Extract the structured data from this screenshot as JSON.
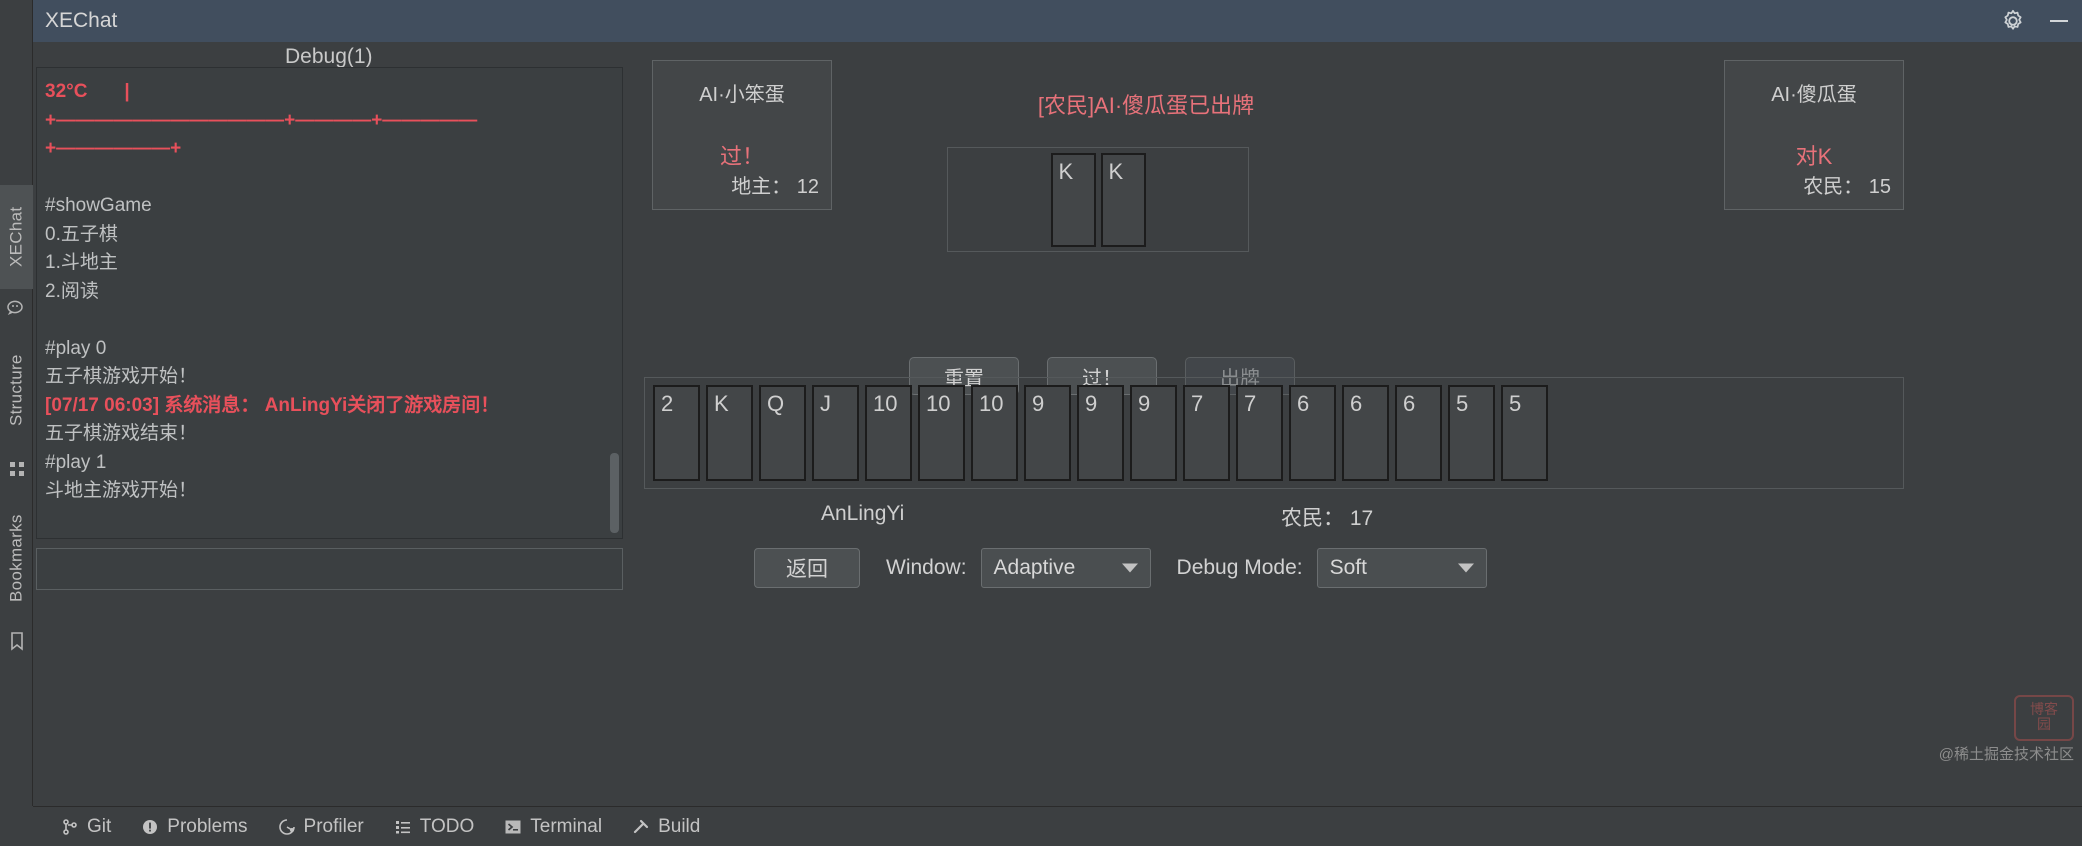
{
  "window": {
    "title": "XEChat",
    "settings_icon": "gear-icon",
    "minimize_icon": "minimize-icon"
  },
  "ide": {
    "left_tabs": [
      {
        "label": "XEChat",
        "selected": true
      },
      {
        "label": "Structure",
        "selected": false
      },
      {
        "label": "Bookmarks",
        "selected": false
      }
    ],
    "left_icons": [
      "wechat-icon",
      "structure-icon",
      "bookmark-icon"
    ],
    "status_items": [
      {
        "label": "Git",
        "icon": "git-branch-icon"
      },
      {
        "label": "Problems",
        "icon": "problems-icon"
      },
      {
        "label": "Profiler",
        "icon": "profiler-icon"
      },
      {
        "label": "TODO",
        "icon": "todo-list-icon"
      },
      {
        "label": "Terminal",
        "icon": "terminal-icon"
      },
      {
        "label": "Build",
        "icon": "build-hammer-icon"
      }
    ]
  },
  "debug": {
    "tab_label": "Debug(1)",
    "lines": [
      {
        "text": "32°C       |",
        "style": "red"
      },
      {
        "text": "+————————————+————+—————",
        "style": "red"
      },
      {
        "text": "+——————+",
        "style": "red"
      },
      {
        "text": "",
        "style": "normal"
      },
      {
        "text": "#showGame",
        "style": "normal"
      },
      {
        "text": "0.五子棋",
        "style": "normal"
      },
      {
        "text": "1.斗地主",
        "style": "normal"
      },
      {
        "text": "2.阅读",
        "style": "normal"
      },
      {
        "text": "",
        "style": "normal"
      },
      {
        "text": "#play 0",
        "style": "normal"
      },
      {
        "text": "五子棋游戏开始！",
        "style": "normal"
      },
      {
        "text": "[07/17 06:03] 系统消息： AnLingYi关闭了游戏房间！",
        "style": "redline"
      },
      {
        "text": "五子棋游戏结束！",
        "style": "normal"
      },
      {
        "text": "#play 1",
        "style": "normal"
      },
      {
        "text": "斗地主游戏开始！",
        "style": "normal"
      }
    ],
    "input_value": ""
  },
  "game": {
    "ai_left": {
      "name": "AI·小笨蛋",
      "action": "过！",
      "role_count": "地主： 12"
    },
    "ai_right": {
      "name": "AI·傻瓜蛋",
      "action": "对K",
      "role_count": "农民： 15"
    },
    "center_message": "[农民]AI·傻瓜蛋已出牌",
    "played_cards": [
      "K",
      "K"
    ],
    "buttons": [
      {
        "label": "重置",
        "disabled": false
      },
      {
        "label": "过！",
        "disabled": false
      },
      {
        "label": "出牌",
        "disabled": true
      }
    ],
    "hand": [
      "2",
      "K",
      "Q",
      "J",
      "10",
      "10",
      "10",
      "9",
      "9",
      "9",
      "7",
      "7",
      "6",
      "6",
      "6",
      "5",
      "5"
    ],
    "player_name": "AnLingYi",
    "player_role_count": "农民： 17",
    "back_button": "返回",
    "window_label": "Window:",
    "window_value": "Adaptive",
    "debug_mode_label": "Debug Mode:",
    "debug_mode_value": "Soft"
  },
  "watermark": {
    "badge_line1": "博客",
    "badge_line2": "园",
    "text": "@稀土掘金技术社区"
  },
  "colors": {
    "accent_red": "#e8505b",
    "soft_red": "#e8727a",
    "title_bar": "#414e5e",
    "bg": "#3c3f41"
  }
}
